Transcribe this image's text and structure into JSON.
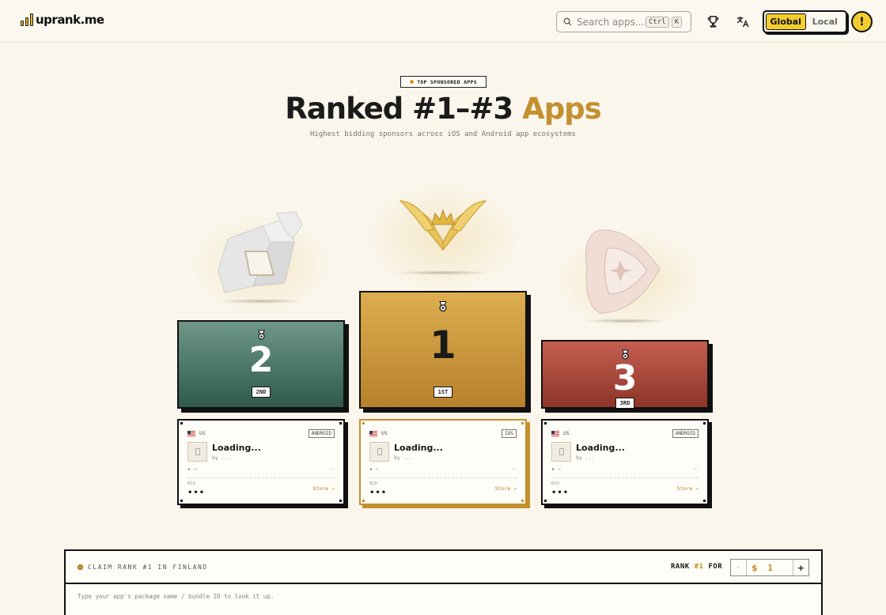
{
  "header": {
    "logo_text": "uprank.me",
    "search": {
      "placeholder": "Search apps...",
      "shortcut_keys": [
        "Ctrl",
        "K"
      ]
    },
    "region_toggle": {
      "options": [
        "Global",
        "Local"
      ],
      "active": "Global"
    },
    "alert_label": "!"
  },
  "hero": {
    "badge": "TOP SPONSORED APPS",
    "title_main": "Ranked #1–#3",
    "title_accent": "Apps",
    "subtitle": "Highest bidding sponsors across iOS and Android app ecosystems"
  },
  "podium": [
    {
      "rank": "2",
      "place": "2ND",
      "color_top": "#6e978a",
      "color_bottom": "#2f5a4c"
    },
    {
      "rank": "1",
      "place": "1ST",
      "color_top": "#dcae50",
      "color_bottom": "#b8812b"
    },
    {
      "rank": "3",
      "place": "3RD",
      "color_top": "#c45f52",
      "color_bottom": "#8d3528"
    }
  ],
  "cards": [
    {
      "country": "US",
      "platform": "ANDROID",
      "title": "Loading...",
      "by": "by ...",
      "rating": "★ —",
      "rating_right": "...",
      "bid_label": "BID",
      "bid_value": "•••",
      "store": "Store ↗"
    },
    {
      "country": "US",
      "platform": "IOS",
      "title": "Loading...",
      "by": "by ...",
      "rating": "★ —",
      "rating_right": "...",
      "bid_label": "BID",
      "bid_value": "•••",
      "store": "Store ↗"
    },
    {
      "country": "US",
      "platform": "ANDROID",
      "title": "Loading...",
      "by": "by ...",
      "rating": "★ —",
      "rating_right": "...",
      "bid_label": "BID",
      "bid_value": "•••",
      "store": "Store ↗"
    }
  ],
  "claim": {
    "label": "CLAIM RANK #1 IN FINLAND",
    "rank_for_prefix": "RANK",
    "rank_for_accent": "#1",
    "rank_for_suffix": "FOR",
    "currency": "$",
    "amount": "1",
    "minus": "-",
    "plus": "+",
    "hint": "Type your app's package name / bundle ID to look it up."
  },
  "colors": {
    "accent_gold": "#c4902f",
    "toggle_yellow": "#f2cd2f",
    "background": "#faf6ec"
  },
  "icons": [
    "search-icon",
    "trophy-icon",
    "translate-icon",
    "medal-icon",
    "crown-wings-icon",
    "hexagon-logo-icon",
    "play-logo-icon"
  ]
}
